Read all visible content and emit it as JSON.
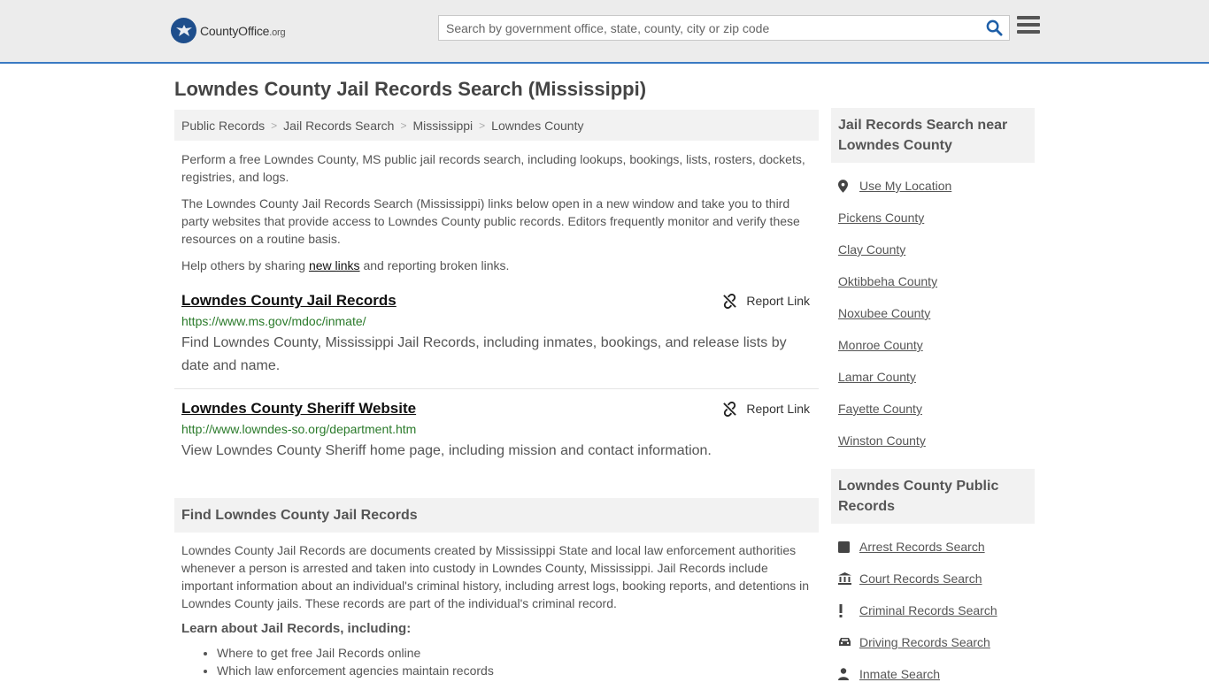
{
  "header": {
    "logo_name": "CountyOffice",
    "logo_tld": ".org",
    "search_placeholder": "Search by government office, state, county, city or zip code"
  },
  "page_title": "Lowndes County Jail Records Search (Mississippi)",
  "breadcrumb": [
    "Public Records",
    "Jail Records Search",
    "Mississippi",
    "Lowndes County"
  ],
  "intro": {
    "p1": "Perform a free Lowndes County, MS public jail records search, including lookups, bookings, lists, rosters, dockets, registries, and logs.",
    "p2": "The Lowndes County Jail Records Search (Mississippi) links below open in a new window and take you to third party websites that provide access to Lowndes County public records. Editors frequently monitor and verify these resources on a routine basis.",
    "p3_before": "Help others by sharing ",
    "p3_link": "new links",
    "p3_after": " and reporting broken links."
  },
  "links": [
    {
      "title": "Lowndes County Jail Records",
      "url": "https://www.ms.gov/mdoc/inmate/",
      "description": "Find Lowndes County, Mississippi Jail Records, including inmates, bookings, and release lists by date and name.",
      "report_label": "Report Link"
    },
    {
      "title": "Lowndes County Sheriff Website",
      "url": "http://www.lowndes-so.org/department.htm",
      "description": "View Lowndes County Sheriff home page, including mission and contact information.",
      "report_label": "Report Link"
    }
  ],
  "find_section": {
    "heading": "Find Lowndes County Jail Records",
    "body": "Lowndes County Jail Records are documents created by Mississippi State and local law enforcement authorities whenever a person is arrested and taken into custody in Lowndes County, Mississippi. Jail Records include important information about an individual's criminal history, including arrest logs, booking reports, and detentions in Lowndes County jails. These records are part of the individual's criminal record.",
    "learn_heading": "Learn about Jail Records, including:",
    "bullets": [
      "Where to get free Jail Records online",
      "Which law enforcement agencies maintain records"
    ]
  },
  "sidebar": {
    "near_heading": "Jail Records Search near Lowndes County",
    "use_location": "Use My Location",
    "near": [
      "Pickens County",
      "Clay County",
      "Oktibbeha County",
      "Noxubee County",
      "Monroe County",
      "Lamar County",
      "Fayette County",
      "Winston County"
    ],
    "public_heading": "Lowndes County Public Records",
    "public": [
      {
        "label": "Arrest Records Search",
        "icon": "square-icon"
      },
      {
        "label": "Court Records Search",
        "icon": "courthouse-icon"
      },
      {
        "label": "Criminal Records Search",
        "icon": "exclamation-icon"
      },
      {
        "label": "Driving Records Search",
        "icon": "car-icon"
      },
      {
        "label": "Inmate Search",
        "icon": "person-icon"
      }
    ]
  }
}
